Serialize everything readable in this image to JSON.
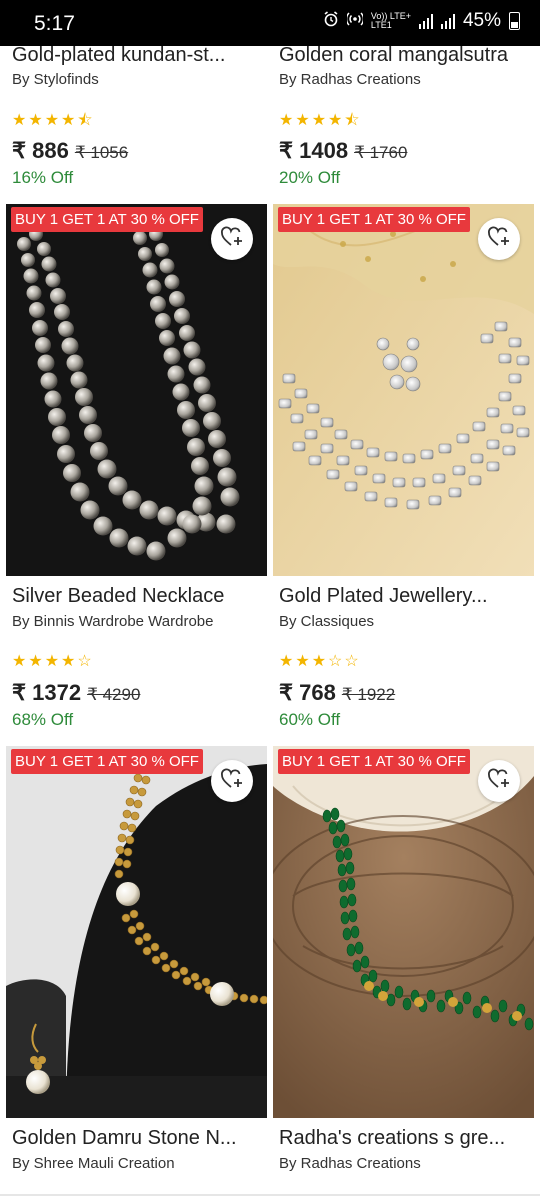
{
  "status": {
    "time": "5:17",
    "battery": "45%",
    "net": "Vo)) LTE+",
    "net2": "LTE1"
  },
  "products": [
    {
      "name": "Gold-plated kundan-st...",
      "brand": "By Stylofinds",
      "rating": 4.5,
      "price": "₹ 886",
      "mrp": "₹ 1056",
      "off": "16% Off"
    },
    {
      "name": "Golden coral mangalsutra",
      "brand": "By Radhas Creations",
      "rating": 4.5,
      "price": "₹ 1408",
      "mrp": "₹ 1760",
      "off": "20% Off"
    },
    {
      "badge": "BUY 1 GET 1 AT 30 % OFF",
      "name": "Silver Beaded Necklace",
      "brand": "By Binnis Wardrobe Wardrobe",
      "rating": 4,
      "price": "₹ 1372",
      "mrp": "₹ 4290",
      "off": "68% Off"
    },
    {
      "badge": "BUY 1 GET 1 AT 30 % OFF",
      "name": "Gold Plated Jewellery...",
      "brand": "By Classiques",
      "rating": 3,
      "price": "₹ 768",
      "mrp": "₹ 1922",
      "off": "60% Off"
    },
    {
      "badge": "BUY 1 GET 1 AT 30 % OFF",
      "name": "Golden Damru Stone N...",
      "brand": "By Shree Mauli Creation"
    },
    {
      "badge": "BUY 1 GET 1 AT 30 % OFF",
      "name": "Radha's creations s gre...",
      "brand": "By Radhas Creations"
    }
  ],
  "colors": {
    "badge": "#e8393d",
    "off": "#2e8b3a",
    "star": "#f3b500"
  }
}
